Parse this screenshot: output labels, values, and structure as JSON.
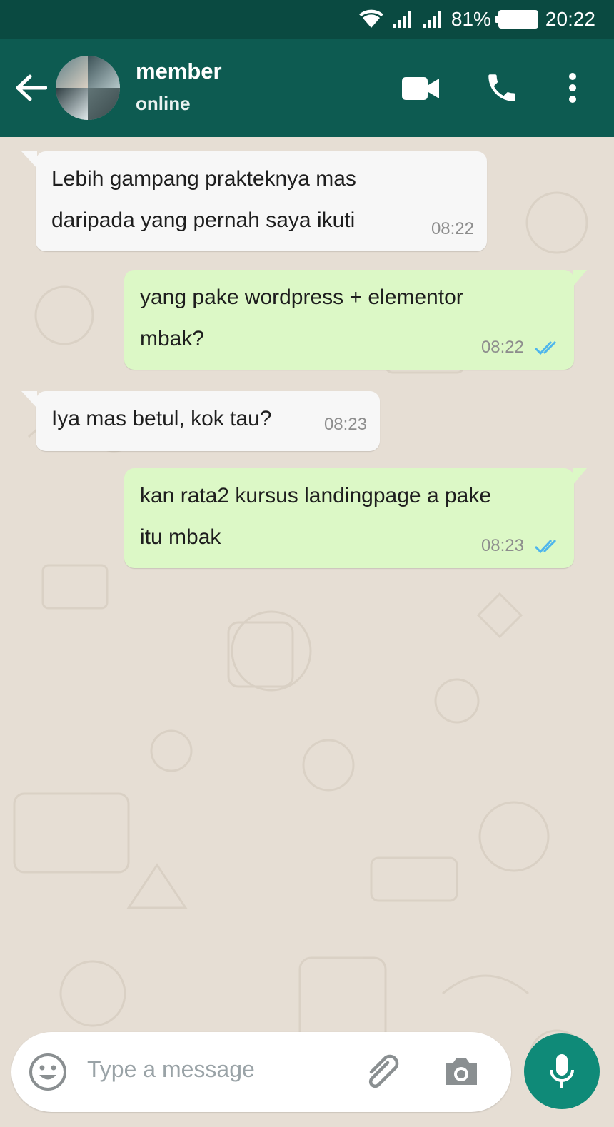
{
  "status_bar": {
    "battery": "81%",
    "time": "20:22",
    "icons": [
      "wifi-icon",
      "signal-icon",
      "signal-icon",
      "battery-icon"
    ]
  },
  "header": {
    "contact_name": "member",
    "contact_status": "online",
    "icons": [
      "back-arrow-icon",
      "video-call-icon",
      "phone-icon",
      "more-vert-icon"
    ]
  },
  "messages": [
    {
      "direction": "in",
      "lines": [
        "Lebih gampang prakteknya mas",
        "daripada yang pernah saya ikuti"
      ],
      "time": "08:22"
    },
    {
      "direction": "out",
      "lines": [
        "yang pake wordpress + elementor",
        "mbak?"
      ],
      "time": "08:22",
      "read": true
    },
    {
      "direction": "in",
      "lines": [
        "Iya mas betul, kok tau?"
      ],
      "time": "08:23"
    },
    {
      "direction": "out",
      "lines": [
        "kan rata2 kursus landingpage a pake",
        "itu mbak"
      ],
      "time": "08:23",
      "read": true
    }
  ],
  "composer": {
    "placeholder": "Type a message",
    "icons": [
      "emoji-icon",
      "attachment-icon",
      "camera-icon",
      "mic-icon"
    ]
  },
  "colors": {
    "status_bar": "#0a4a41",
    "header": "#0d5b51",
    "wallpaper": "#e6ded4",
    "bubble_in": "#f7f7f7",
    "bubble_out": "#dcf8c6",
    "read_ticks": "#4fb6ec",
    "mic_button": "#0f8a78"
  }
}
